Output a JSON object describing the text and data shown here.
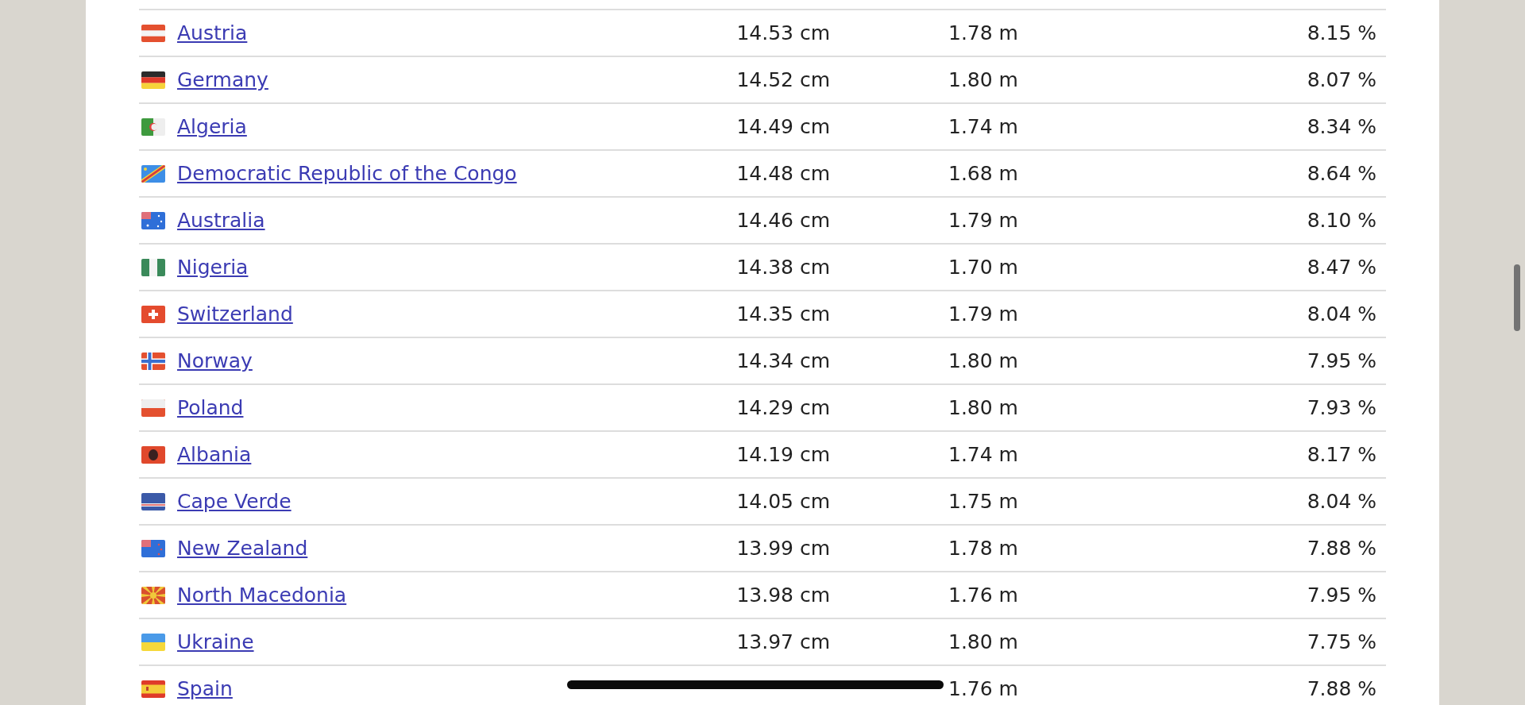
{
  "rows": [
    {
      "country": "Austria",
      "length": "14.53 cm",
      "height": "1.78 m",
      "ratio": "8.15 %"
    },
    {
      "country": "Germany",
      "length": "14.52 cm",
      "height": "1.80 m",
      "ratio": "8.07 %"
    },
    {
      "country": "Algeria",
      "length": "14.49 cm",
      "height": "1.74 m",
      "ratio": "8.34 %"
    },
    {
      "country": "Democratic Republic of the Congo",
      "length": "14.48 cm",
      "height": "1.68 m",
      "ratio": "8.64 %"
    },
    {
      "country": "Australia",
      "length": "14.46 cm",
      "height": "1.79 m",
      "ratio": "8.10 %"
    },
    {
      "country": "Nigeria",
      "length": "14.38 cm",
      "height": "1.70 m",
      "ratio": "8.47 %"
    },
    {
      "country": "Switzerland",
      "length": "14.35 cm",
      "height": "1.79 m",
      "ratio": "8.04 %"
    },
    {
      "country": "Norway",
      "length": "14.34 cm",
      "height": "1.80 m",
      "ratio": "7.95 %"
    },
    {
      "country": "Poland",
      "length": "14.29 cm",
      "height": "1.80 m",
      "ratio": "7.93 %"
    },
    {
      "country": "Albania",
      "length": "14.19 cm",
      "height": "1.74 m",
      "ratio": "8.17 %"
    },
    {
      "country": "Cape Verde",
      "length": "14.05 cm",
      "height": "1.75 m",
      "ratio": "8.04 %"
    },
    {
      "country": "New Zealand",
      "length": "13.99 cm",
      "height": "1.78 m",
      "ratio": "7.88 %"
    },
    {
      "country": "North Macedonia",
      "length": "13.98 cm",
      "height": "1.76 m",
      "ratio": "7.95 %"
    },
    {
      "country": "Ukraine",
      "length": "13.97 cm",
      "height": "1.80 m",
      "ratio": "7.75 %"
    },
    {
      "country": "Spain",
      "height": "1.76 m",
      "ratio": "7.88 %"
    }
  ]
}
